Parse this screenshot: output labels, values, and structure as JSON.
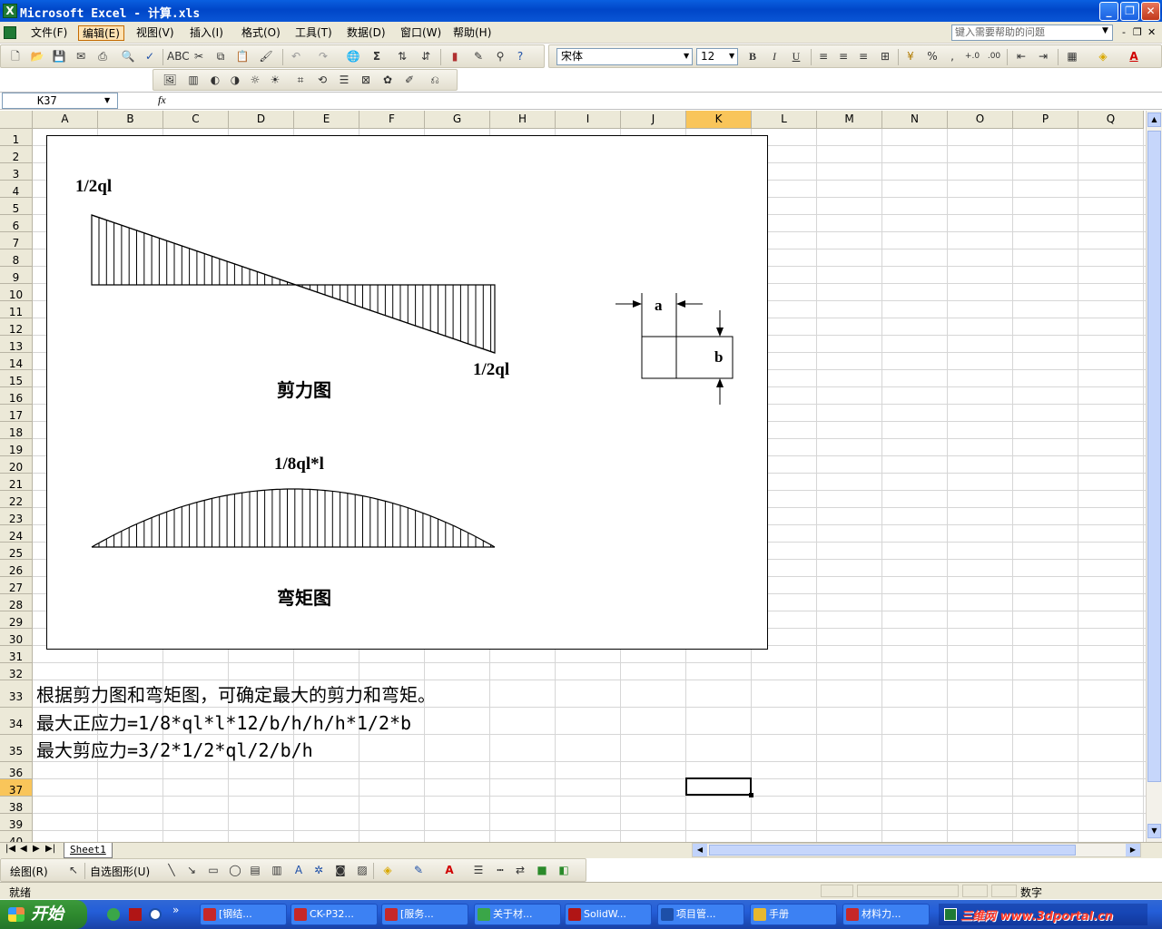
{
  "window": {
    "title": "Microsoft Excel - 计算.xls"
  },
  "menu": {
    "items": [
      "文件(F)",
      "编辑(E)",
      "视图(V)",
      "插入(I)",
      "格式(O)",
      "工具(T)",
      "数据(D)",
      "窗口(W)",
      "帮助(H)"
    ]
  },
  "help_placeholder": "键入需要帮助的问题",
  "format_toolbar": {
    "font_name": "宋体",
    "font_size": "12"
  },
  "formula_bar": {
    "cell_ref": "K37",
    "fx": "fx",
    "content": ""
  },
  "columns": [
    "A",
    "B",
    "C",
    "D",
    "E",
    "F",
    "G",
    "H",
    "I",
    "J",
    "K",
    "L",
    "M",
    "N",
    "O",
    "P",
    "Q"
  ],
  "rows": [
    "1",
    "2",
    "3",
    "4",
    "5",
    "6",
    "7",
    "8",
    "9",
    "10",
    "11",
    "12",
    "13",
    "14",
    "15",
    "16",
    "17",
    "18",
    "19",
    "20",
    "21",
    "22",
    "23",
    "24",
    "25",
    "26",
    "27",
    "28",
    "29",
    "30",
    "31",
    "32",
    "33",
    "34",
    "35",
    "36",
    "37",
    "38",
    "39",
    "40"
  ],
  "selected_cell": {
    "column": "K",
    "row": "37"
  },
  "diagram": {
    "shear_left_label": "1/2ql",
    "shear_right_label": "1/2ql",
    "shear_title": "剪力图",
    "moment_peak_label": "1/8ql*l",
    "moment_title": "弯矩图",
    "section_width_label": "a",
    "section_height_label": "b"
  },
  "cells": {
    "row33": "根据剪力图和弯矩图，可确定最大的剪力和弯矩。",
    "row34": "最大正应力=1/8*ql*l*12/b/h/h/h*1/2*b",
    "row35": "最大剪应力=3/2*1/2*ql/2/b/h"
  },
  "sheet_tab": "Sheet1",
  "draw_toolbar": {
    "draw_menu": "绘图(R)",
    "autoshapes": "自选图形(U)"
  },
  "status": {
    "left": "就绪",
    "mode": "数字"
  },
  "taskbar": {
    "start": "开始",
    "tasks": [
      "[钢结...",
      "CK-P32...",
      "[服务...",
      "关于材...",
      "SolidW...",
      "项目管...",
      "手册",
      "材料力..."
    ],
    "watermark": "三维网 www.3dportal.cn"
  },
  "colors": {
    "title_bar": "#0a5fe0",
    "selection": "#f9c55a",
    "start_button": "#2e8a2e"
  }
}
